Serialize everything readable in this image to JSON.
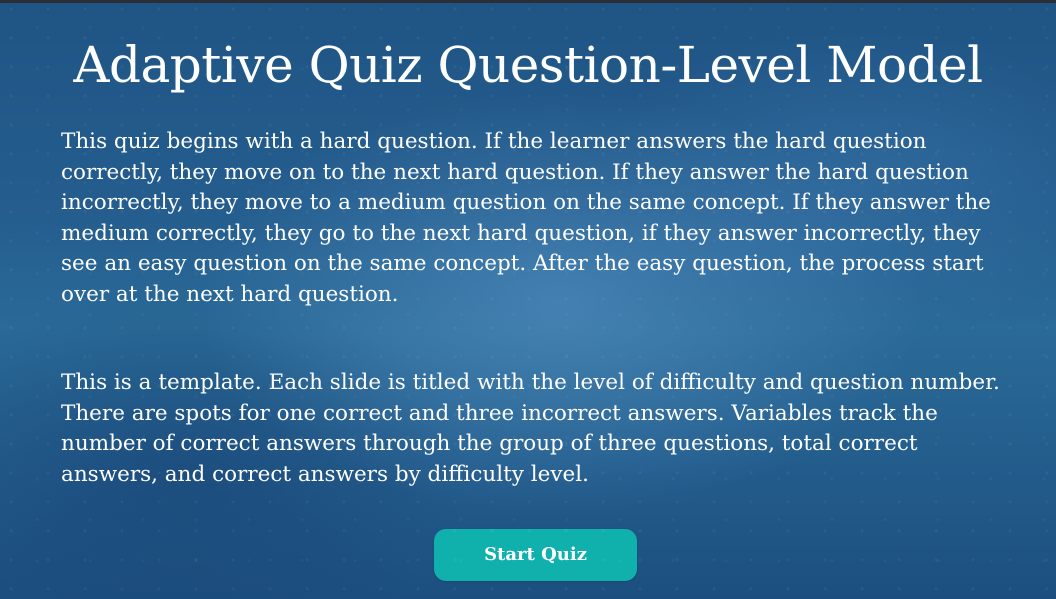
{
  "slide": {
    "title": "Adaptive Quiz Question-Level Model",
    "paragraphs": [
      "This quiz begins with a hard question. If the learner answers the hard question correctly, they move on to the next hard question. If they answer the hard question incorrectly, they move to a medium question on the same concept. If they answer the medium correctly, they go to the next hard question, if they answer incorrectly, they see an easy question on the same concept. After the easy question, the process start over at the next hard question.",
      "This is a template. Each slide is titled with the level of difficulty and question number. There are spots for one correct and three incorrect answers. Variables track the number of correct answers through the group of three questions, total correct answers, and correct answers by difficulty level."
    ],
    "start_button_label": "Start Quiz"
  },
  "colors": {
    "background": "#1f5585",
    "text": "#ffffff",
    "button": "#10b1ad"
  }
}
